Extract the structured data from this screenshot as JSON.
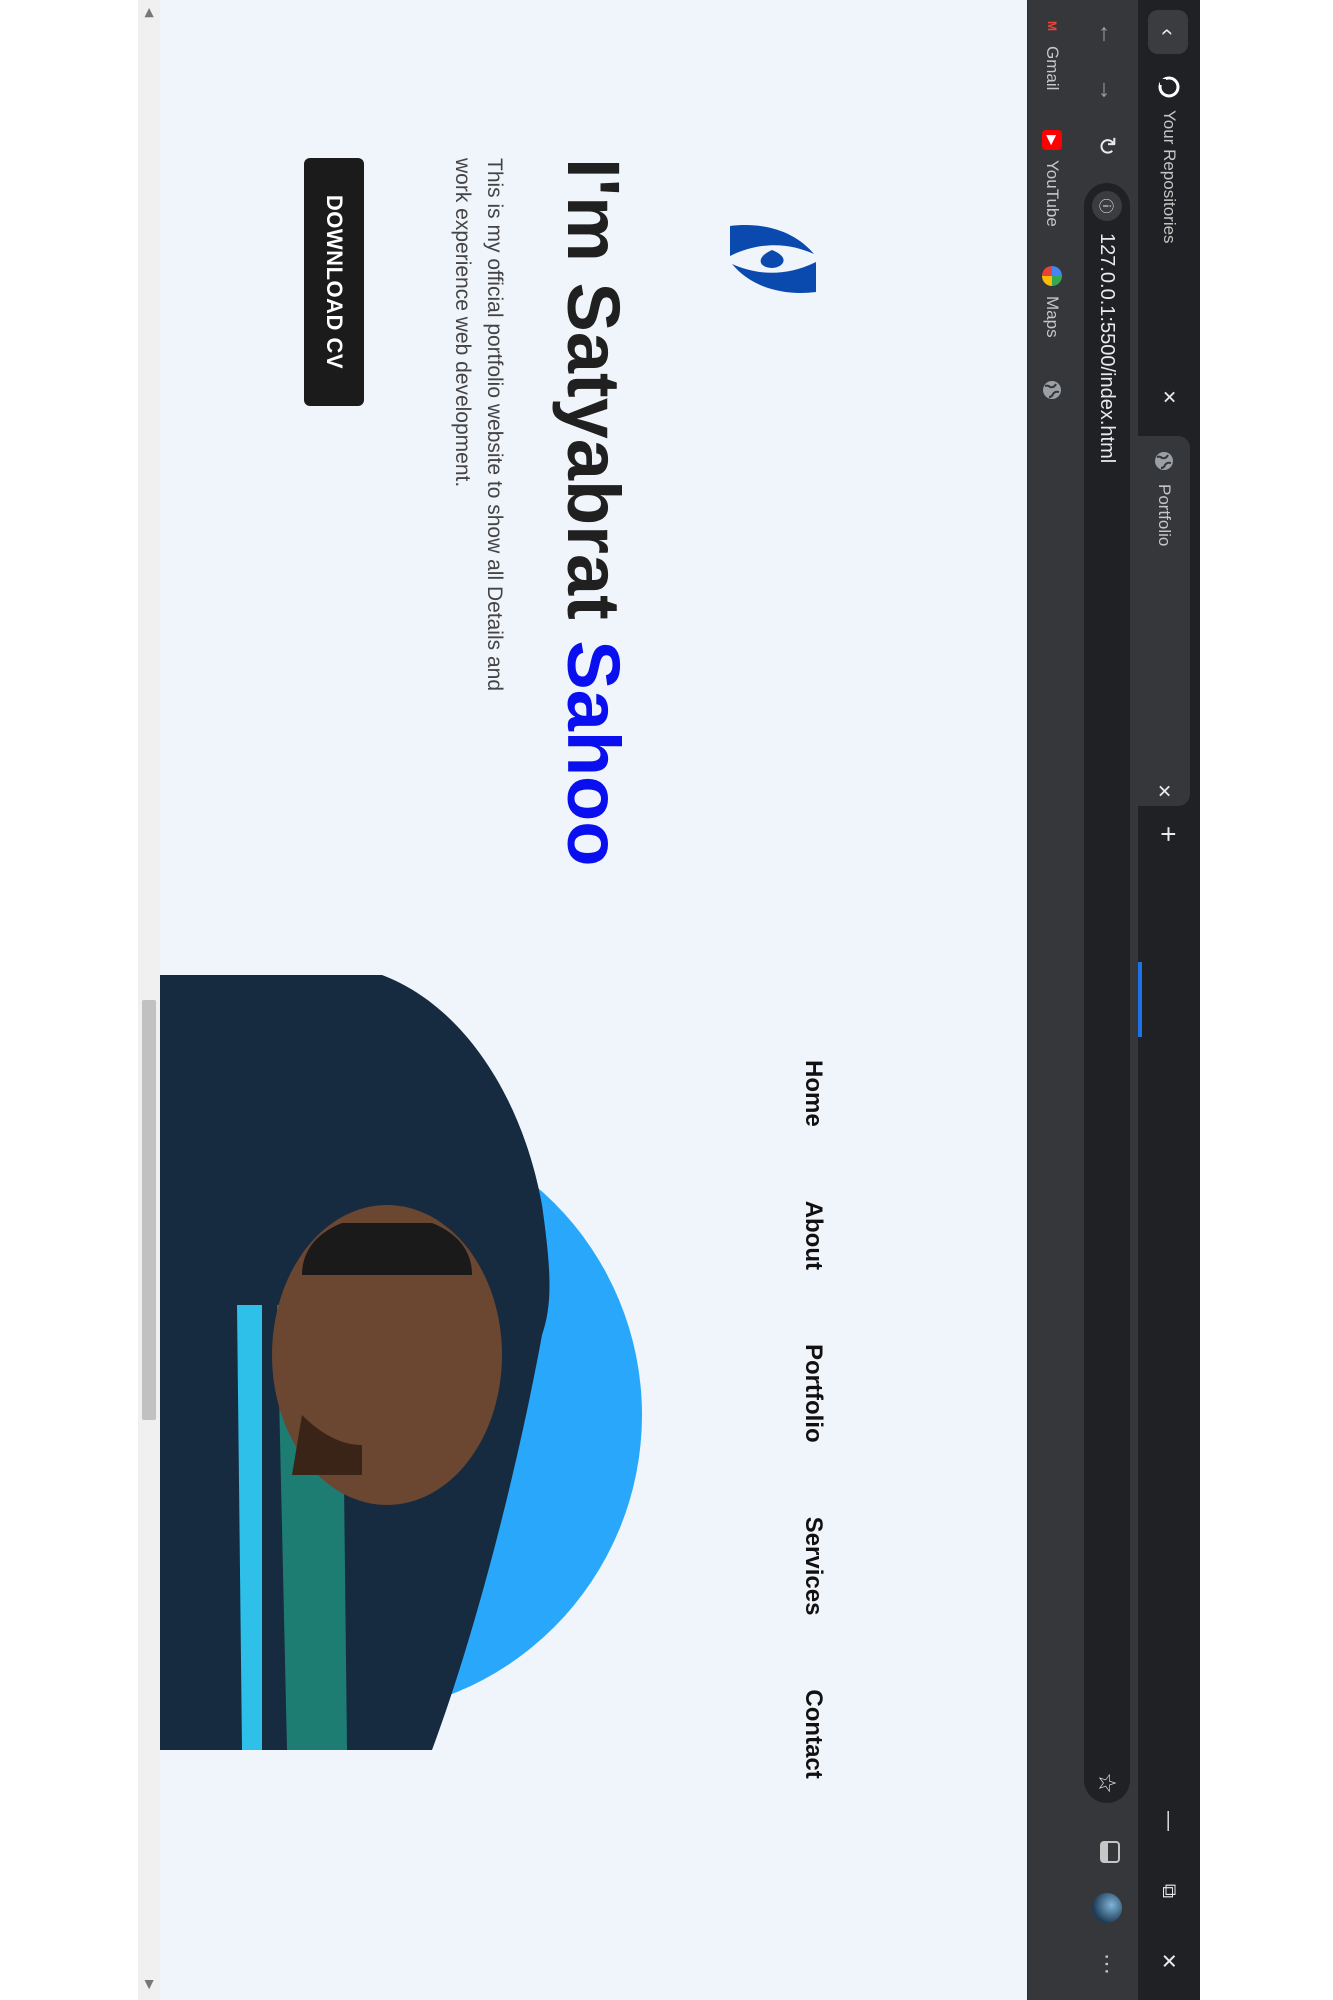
{
  "browser": {
    "tabs": [
      {
        "title": "Your Repositories",
        "icon": "github-icon"
      },
      {
        "title": "Portfolio",
        "icon": "globe-icon",
        "active": true
      }
    ],
    "url": "127.0.0.1:5500/index.html",
    "bookmarks": [
      {
        "label": "Gmail",
        "icon": "gmail-icon"
      },
      {
        "label": "YouTube",
        "icon": "youtube-icon"
      },
      {
        "label": "Maps",
        "icon": "maps-icon"
      },
      {
        "label": "",
        "icon": "globe-icon"
      }
    ]
  },
  "site": {
    "nav": [
      "Home",
      "About",
      "Portfolio",
      "Services",
      "Contact"
    ],
    "hero": {
      "title_prefix": "I'm Satyabrat",
      "title_highlight": "Sahoo",
      "description": "This is my official portfolio website to show all Details and work experience web development.",
      "cta": "DOWNLOAD CV"
    }
  },
  "colors": {
    "page_bg": "#f0f4fb",
    "highlight": "#0a0ff0",
    "portrait_circle": "#29a8fb",
    "logo": "#0a49ad",
    "button_bg": "#1b1b1b"
  }
}
